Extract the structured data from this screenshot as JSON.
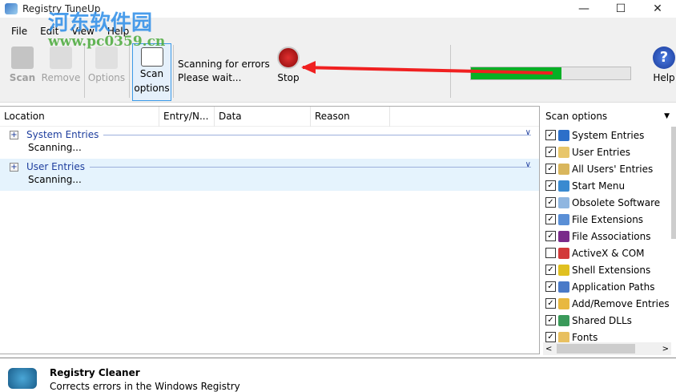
{
  "window": {
    "title": "Registry TuneUp",
    "minimize": "—",
    "maximize": "☐",
    "close": "✕"
  },
  "watermark": {
    "cn": "河东软件园",
    "url": "www.pc0359.cn"
  },
  "menu": [
    "File",
    "Edit",
    "View",
    "Help"
  ],
  "toolbar": {
    "scan": "Scan",
    "remove": "Remove",
    "options": "Options",
    "scan_options_1": "Scan",
    "scan_options_2": "options",
    "status_1": "Scanning for errors",
    "status_2": "Please wait...",
    "stop": "Stop",
    "help": "Help",
    "help_glyph": "?",
    "progress_percent": 57
  },
  "columns": [
    "Location",
    "Entry/N...",
    "Data",
    "Reason"
  ],
  "groups": [
    {
      "title": "System Entries",
      "status": "Scanning..."
    },
    {
      "title": "User Entries",
      "status": "Scanning..."
    }
  ],
  "scan_options": {
    "title": "Scan options",
    "items": [
      {
        "label": "System Entries",
        "checked": true,
        "color": "#2c6fc9"
      },
      {
        "label": "User Entries",
        "checked": true,
        "color": "#e8c66a"
      },
      {
        "label": "All Users' Entries",
        "checked": true,
        "color": "#d9b65c"
      },
      {
        "label": "Start Menu",
        "checked": true,
        "color": "#3a8ad0"
      },
      {
        "label": "Obsolete Software",
        "checked": true,
        "color": "#8fb6e0"
      },
      {
        "label": "File Extensions",
        "checked": true,
        "color": "#5a8fd6"
      },
      {
        "label": "File Associations",
        "checked": true,
        "color": "#7a2a8a"
      },
      {
        "label": "ActiveX & COM",
        "checked": false,
        "color": "#d23a3a"
      },
      {
        "label": "Shell Extensions",
        "checked": true,
        "color": "#e0c020"
      },
      {
        "label": "Application Paths",
        "checked": true,
        "color": "#4a7ac8"
      },
      {
        "label": "Add/Remove Entries",
        "checked": true,
        "color": "#e8b840"
      },
      {
        "label": "Shared DLLs",
        "checked": true,
        "color": "#3a9a5a"
      },
      {
        "label": "Fonts",
        "checked": true,
        "color": "#e8c060"
      }
    ]
  },
  "footer": {
    "title": "Registry Cleaner",
    "subtitle": "Corrects errors in the Windows Registry"
  }
}
